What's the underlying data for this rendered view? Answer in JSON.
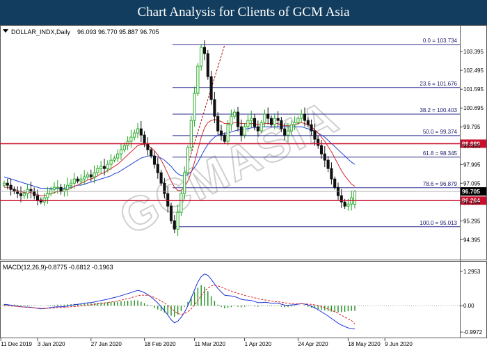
{
  "banner": {
    "title": "Chart Analysis for Clients of GCM Asia"
  },
  "watermark": "GCMASIA",
  "chart_data": [
    {
      "type": "candlestick",
      "title": "DOLLAR_INDX,Daily",
      "ohlc_header": "96.093 96.770 95.887 96.705",
      "ohlc_last": {
        "open": 96.093,
        "high": 96.77,
        "low": 95.887,
        "close": 96.705
      },
      "ylim": [
        94.34,
        104.0
      ],
      "y_ticks": [
        "103.395",
        "102.495",
        "101.595",
        "100.695",
        "99.795",
        "98.895",
        "97.995",
        "97.095",
        "96.195",
        "95.295",
        "94.395"
      ],
      "x_ticks": [
        "11 Dec 2019",
        "3 Jan 2020",
        "27 Jan 2020",
        "18 Feb 2020",
        "11 Mar 2020",
        "1 Apr 2020",
        "24 Apr 2020",
        "18 May 2020",
        "9 Jun 2020"
      ],
      "grid": false,
      "fibonacci": [
        {
          "label": "0.0 = 103.734",
          "value": 103.734
        },
        {
          "label": "23.6 = 101.676",
          "value": 101.676
        },
        {
          "label": "38.2 = 100.403",
          "value": 100.403
        },
        {
          "label": "50.0 = 99.374",
          "value": 99.374
        },
        {
          "label": "61.8 = 98.345",
          "value": 98.345
        },
        {
          "label": "78.6 =  96.879",
          "value": 96.879
        },
        {
          "label": "100.0 = 95.013",
          "value": 95.013
        }
      ],
      "resistance": {
        "label": "98.989",
        "value": 98.989
      },
      "support": {
        "label": "96.264",
        "value": 96.264
      },
      "current_price": {
        "label": "96.705",
        "value": 96.705
      },
      "closes": [
        97.1,
        97.0,
        96.8,
        96.7,
        96.6,
        96.5,
        96.6,
        96.8,
        96.7,
        96.5,
        96.3,
        96.2,
        96.4,
        96.6,
        96.8,
        96.9,
        96.9,
        96.7,
        96.8,
        97.0,
        97.1,
        97.3,
        97.2,
        97.3,
        97.4,
        97.5,
        97.4,
        97.6,
        97.8,
        97.9,
        97.8,
        98.0,
        98.2,
        98.3,
        98.5,
        98.7,
        98.9,
        99.1,
        99.3,
        99.5,
        99.7,
        99.4,
        99.0,
        98.7,
        98.4,
        98.0,
        97.6,
        97.1,
        96.6,
        96.0,
        95.3,
        94.9,
        95.7,
        96.6,
        97.6,
        98.8,
        100.1,
        101.4,
        102.7,
        103.6,
        103.3,
        102.2,
        101.1,
        100.3,
        99.6,
        99.4,
        99.1,
        99.9,
        100.3,
        100.5,
        99.8,
        99.4,
        99.8,
        100.1,
        100.2,
        99.8,
        99.6,
        100.0,
        100.4,
        100.2,
        99.9,
        100.2,
        100.1,
        99.7,
        99.4,
        99.6,
        99.9,
        100.0,
        100.2,
        100.4,
        100.1,
        99.9,
        99.6,
        99.2,
        98.9,
        98.5,
        98.2,
        97.8,
        97.3,
        96.9,
        96.5,
        96.2,
        96.0,
        96.1,
        96.4,
        96.7
      ],
      "ma_red": [
        96.9,
        96.9,
        96.85,
        96.8,
        96.75,
        96.7,
        96.65,
        96.65,
        96.65,
        96.6,
        96.55,
        96.5,
        96.5,
        96.55,
        96.6,
        96.65,
        96.7,
        96.7,
        96.75,
        96.8,
        96.85,
        96.95,
        97.0,
        97.1,
        97.15,
        97.25,
        97.3,
        97.35,
        97.45,
        97.55,
        97.6,
        97.7,
        97.8,
        97.9,
        98.0,
        98.15,
        98.3,
        98.45,
        98.6,
        98.75,
        98.9,
        98.95,
        98.95,
        98.9,
        98.8,
        98.65,
        98.45,
        98.2,
        97.9,
        97.55,
        97.2,
        96.9,
        96.75,
        96.75,
        96.9,
        97.2,
        97.6,
        98.1,
        98.7,
        99.3,
        99.75,
        100.0,
        100.1,
        100.15,
        100.1,
        100.05,
        99.95,
        99.95,
        99.95,
        100.0,
        100.0,
        99.95,
        99.95,
        99.95,
        99.95,
        99.95,
        99.9,
        99.9,
        99.95,
        99.95,
        99.95,
        99.95,
        99.95,
        99.9,
        99.85,
        99.85,
        99.85,
        99.9,
        99.95,
        100.0,
        99.95,
        99.9,
        99.8,
        99.65,
        99.5,
        99.3,
        99.1,
        98.85,
        98.6,
        98.3,
        98.0,
        97.7,
        97.45,
        97.25,
        97.05,
        96.95
      ],
      "ma_blue": [
        97.4,
        97.35,
        97.3,
        97.25,
        97.2,
        97.15,
        97.1,
        97.05,
        97.0,
        96.95,
        96.9,
        96.85,
        96.85,
        96.85,
        96.85,
        96.85,
        96.85,
        96.85,
        96.85,
        96.9,
        96.9,
        96.95,
        97.0,
        97.0,
        97.05,
        97.1,
        97.15,
        97.2,
        97.25,
        97.3,
        97.35,
        97.4,
        97.45,
        97.55,
        97.6,
        97.7,
        97.8,
        97.9,
        98.0,
        98.1,
        98.2,
        98.3,
        98.35,
        98.4,
        98.4,
        98.4,
        98.35,
        98.3,
        98.2,
        98.05,
        97.9,
        97.7,
        97.55,
        97.45,
        97.45,
        97.5,
        97.65,
        97.85,
        98.1,
        98.4,
        98.7,
        98.95,
        99.15,
        99.3,
        99.4,
        99.45,
        99.5,
        99.5,
        99.55,
        99.6,
        99.65,
        99.65,
        99.7,
        99.7,
        99.75,
        99.75,
        99.75,
        99.8,
        99.8,
        99.8,
        99.8,
        99.8,
        99.8,
        99.8,
        99.8,
        99.8,
        99.8,
        99.8,
        99.8,
        99.8,
        99.75,
        99.7,
        99.65,
        99.6,
        99.5,
        99.4,
        99.3,
        99.15,
        99.0,
        98.85,
        98.7,
        98.55,
        98.4,
        98.25,
        98.1,
        98.0
      ]
    },
    {
      "type": "macd",
      "title": "MACD(12,26,9)",
      "values_header": "-0.8775 -0.6812 -0.1963",
      "ylim": [
        -1.1,
        1.35
      ],
      "y_ticks": [
        "1.2953",
        "0.00",
        "-0.9972"
      ],
      "histogram": [
        0.05,
        0.05,
        0.04,
        0.04,
        0.03,
        0.03,
        0.02,
        0.02,
        0.01,
        0.01,
        0.0,
        -0.01,
        0.0,
        0.01,
        0.02,
        0.03,
        0.04,
        0.04,
        0.04,
        0.05,
        0.06,
        0.07,
        0.07,
        0.08,
        0.08,
        0.09,
        0.09,
        0.1,
        0.11,
        0.12,
        0.12,
        0.13,
        0.14,
        0.15,
        0.16,
        0.17,
        0.18,
        0.19,
        0.2,
        0.2,
        0.2,
        0.15,
        0.1,
        0.04,
        -0.02,
        -0.08,
        -0.14,
        -0.2,
        -0.26,
        -0.32,
        -0.38,
        -0.42,
        -0.33,
        -0.2,
        -0.04,
        0.14,
        0.33,
        0.52,
        0.68,
        0.78,
        0.72,
        0.55,
        0.36,
        0.18,
        0.04,
        -0.05,
        -0.1,
        -0.08,
        -0.05,
        -0.02,
        -0.04,
        -0.06,
        -0.04,
        -0.02,
        -0.01,
        -0.03,
        -0.04,
        -0.02,
        0.0,
        -0.01,
        -0.02,
        -0.01,
        -0.02,
        -0.04,
        -0.06,
        -0.05,
        -0.03,
        -0.02,
        -0.01,
        0.0,
        -0.02,
        -0.04,
        -0.07,
        -0.1,
        -0.13,
        -0.16,
        -0.18,
        -0.2,
        -0.22,
        -0.24,
        -0.25,
        -0.24,
        -0.23,
        -0.21,
        -0.2,
        -0.196
      ],
      "macd_line": [
        0.05,
        0.04,
        0.02,
        0.0,
        -0.02,
        -0.04,
        -0.05,
        -0.05,
        -0.06,
        -0.08,
        -0.1,
        -0.12,
        -0.11,
        -0.09,
        -0.07,
        -0.05,
        -0.04,
        -0.04,
        -0.03,
        -0.01,
        0.01,
        0.04,
        0.05,
        0.07,
        0.09,
        0.11,
        0.12,
        0.14,
        0.17,
        0.2,
        0.22,
        0.25,
        0.28,
        0.31,
        0.34,
        0.38,
        0.42,
        0.46,
        0.5,
        0.54,
        0.58,
        0.55,
        0.49,
        0.42,
        0.33,
        0.22,
        0.1,
        -0.04,
        -0.19,
        -0.35,
        -0.53,
        -0.65,
        -0.58,
        -0.44,
        -0.25,
        0.0,
        0.29,
        0.6,
        0.9,
        1.1,
        1.2,
        1.15,
        1.0,
        0.82,
        0.65,
        0.52,
        0.4,
        0.38,
        0.37,
        0.35,
        0.3,
        0.24,
        0.22,
        0.21,
        0.2,
        0.16,
        0.12,
        0.12,
        0.13,
        0.12,
        0.09,
        0.1,
        0.09,
        0.06,
        0.02,
        0.02,
        0.03,
        0.04,
        0.06,
        0.08,
        0.06,
        0.03,
        -0.02,
        -0.08,
        -0.15,
        -0.23,
        -0.31,
        -0.39,
        -0.48,
        -0.57,
        -0.66,
        -0.73,
        -0.79,
        -0.84,
        -0.87,
        -0.8775
      ],
      "signal_line": [
        0.0,
        0.0,
        -0.01,
        -0.02,
        -0.03,
        -0.04,
        -0.05,
        -0.06,
        -0.07,
        -0.08,
        -0.09,
        -0.1,
        -0.1,
        -0.1,
        -0.09,
        -0.08,
        -0.07,
        -0.07,
        -0.06,
        -0.05,
        -0.04,
        -0.03,
        -0.02,
        -0.01,
        0.01,
        0.02,
        0.03,
        0.05,
        0.07,
        0.09,
        0.1,
        0.12,
        0.14,
        0.16,
        0.18,
        0.21,
        0.24,
        0.27,
        0.3,
        0.34,
        0.38,
        0.4,
        0.4,
        0.39,
        0.36,
        0.31,
        0.25,
        0.18,
        0.1,
        0.01,
        -0.1,
        -0.21,
        -0.29,
        -0.33,
        -0.3,
        -0.23,
        -0.12,
        0.03,
        0.2,
        0.38,
        0.54,
        0.67,
        0.75,
        0.77,
        0.75,
        0.71,
        0.65,
        0.6,
        0.55,
        0.51,
        0.47,
        0.43,
        0.39,
        0.36,
        0.33,
        0.3,
        0.27,
        0.24,
        0.22,
        0.2,
        0.18,
        0.16,
        0.15,
        0.13,
        0.11,
        0.09,
        0.08,
        0.07,
        0.07,
        0.07,
        0.07,
        0.06,
        0.05,
        0.03,
        0.01,
        -0.03,
        -0.07,
        -0.12,
        -0.17,
        -0.23,
        -0.29,
        -0.36,
        -0.43,
        -0.5,
        -0.56,
        -0.6812
      ]
    }
  ],
  "colors": {
    "banner_bg": "#123d5e",
    "bull_candle": "#1aa51a",
    "bear_candle": "#111111",
    "ma_red": "#d4262e",
    "ma_blue": "#2244d8",
    "fib_line": "#2b2b8f",
    "key_level": "#c8102e",
    "macd_hist": "#1f8f1f",
    "macd_signal": "#e02020",
    "macd_line": "#1a30d8"
  }
}
